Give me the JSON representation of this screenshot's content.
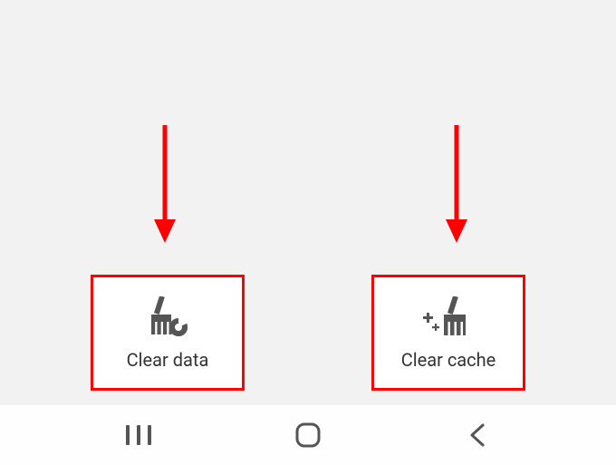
{
  "storage": {
    "clear_data_label": "Clear data",
    "clear_cache_label": "Clear cache"
  },
  "annotation": {
    "arrow_color": "#ff0000",
    "highlight_color": "#ff0000"
  },
  "nav": {
    "recents": "recents",
    "home": "home",
    "back": "back"
  }
}
